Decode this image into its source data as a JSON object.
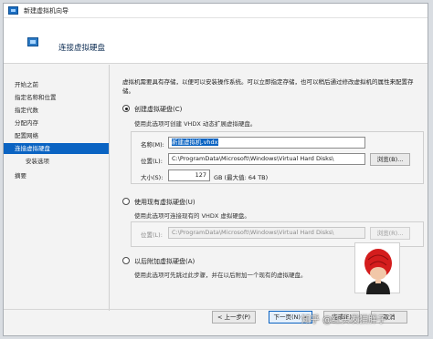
{
  "window": {
    "title": "新建虚拟机向导"
  },
  "header": {
    "title": "连接虚拟硬盘"
  },
  "sidebar": {
    "items": [
      {
        "label": "开始之前"
      },
      {
        "label": "指定名称和位置"
      },
      {
        "label": "指定代数"
      },
      {
        "label": "分配内存"
      },
      {
        "label": "配置网络"
      },
      {
        "label": "连接虚拟硬盘"
      },
      {
        "label": "安装选项"
      },
      {
        "label": "摘要"
      }
    ]
  },
  "main": {
    "description": "虚拟机需要具有存储，以便可以安装操作系统。可以立即指定存储，也可以稍后通过修改虚拟机的属性来配置存储。",
    "create_option": {
      "label": "创建虚拟硬盘(C)",
      "hint": "使用此选项可创建 VHDX 动态扩展虚拟硬盘。",
      "name_label": "名称(M):",
      "name_value": "新建虚拟机.vhdx",
      "location_label": "位置(L):",
      "location_value": "C:\\ProgramData\\Microsoft\\Windows\\Virtual Hard Disks\\",
      "browse_label": "浏览(B)...",
      "size_label": "大小(S):",
      "size_value": "127",
      "size_unit": "GB (最大值: 64 TB)"
    },
    "existing_option": {
      "label": "使用现有虚拟硬盘(U)",
      "hint": "使用此选项可连接现有的 VHDX 虚拟硬盘。",
      "location_label": "位置(L):",
      "location_value": "C:\\ProgramData\\Microsoft\\Windows\\Virtual Hard Disks\\",
      "browse_label": "浏览(R)..."
    },
    "later_option": {
      "label": "以后附加虚拟硬盘(A)",
      "hint": "使用此选项可先跳过此步骤，并在以后附加一个现有的虚拟硬盘。"
    }
  },
  "footer": {
    "prev_label": "< 上一步(P)",
    "next_label": "下一页(N) >",
    "finish_label": "完成(F)",
    "cancel_label": "取消"
  },
  "watermark": "知乎 @红头发猫胖子",
  "colors": {
    "accent": "#0a63c2",
    "avatar_hair": "#d41d1d"
  }
}
